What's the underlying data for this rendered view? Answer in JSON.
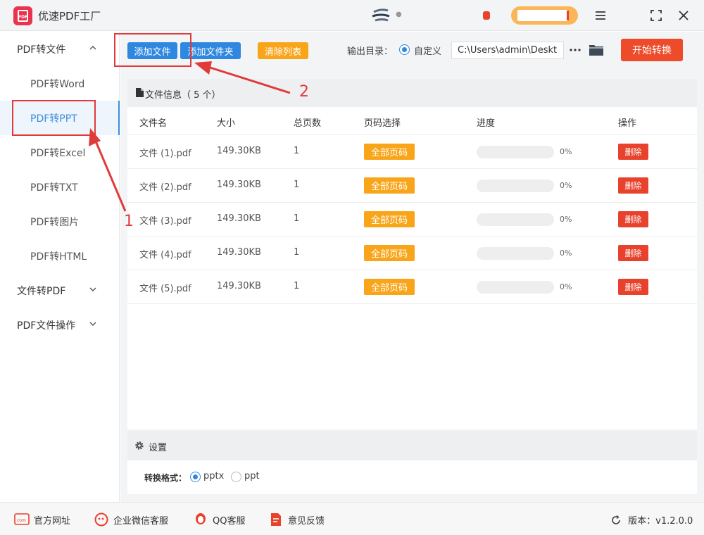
{
  "app": {
    "title": "优速PDF工厂",
    "logo_text": "PDF"
  },
  "sidebar": {
    "groups": [
      {
        "label": "PDF转文件",
        "expanded": true
      },
      {
        "label": "文件转PDF",
        "expanded": false
      },
      {
        "label": "PDF文件操作",
        "expanded": false
      }
    ],
    "items": [
      {
        "label": "PDF转Word"
      },
      {
        "label": "PDF转PPT",
        "active": true
      },
      {
        "label": "PDF转Excel"
      },
      {
        "label": "PDF转TXT"
      },
      {
        "label": "PDF转图片"
      },
      {
        "label": "PDF转HTML"
      }
    ]
  },
  "toolbar": {
    "add_file": "添加文件",
    "add_folder": "添加文件夹",
    "clear_list": "清除列表",
    "output_label": "输出目录：",
    "output_option": "自定义",
    "output_path": "C:\\Users\\admin\\Desktop",
    "start": "开始转换"
  },
  "file_panel": {
    "header": "文件信息（ 5 个）",
    "columns": [
      "文件名",
      "大小",
      "总页数",
      "页码选择",
      "进度",
      "操作"
    ],
    "rows": [
      {
        "name": "文件 (1).pdf",
        "size": "149.30KB",
        "pages": "1",
        "page_sel": "全部页码",
        "progress": 0,
        "progress_text": "0%",
        "action": "删除"
      },
      {
        "name": "文件 (2).pdf",
        "size": "149.30KB",
        "pages": "1",
        "page_sel": "全部页码",
        "progress": 0,
        "progress_text": "0%",
        "action": "删除"
      },
      {
        "name": "文件 (3).pdf",
        "size": "149.30KB",
        "pages": "1",
        "page_sel": "全部页码",
        "progress": 0,
        "progress_text": "0%",
        "action": "删除"
      },
      {
        "name": "文件 (4).pdf",
        "size": "149.30KB",
        "pages": "1",
        "page_sel": "全部页码",
        "progress": 0,
        "progress_text": "0%",
        "action": "删除"
      },
      {
        "name": "文件 (5).pdf",
        "size": "149.30KB",
        "pages": "1",
        "page_sel": "全部页码",
        "progress": 0,
        "progress_text": "0%",
        "action": "删除"
      }
    ]
  },
  "settings": {
    "title": "设置",
    "format_label": "转换格式：",
    "options": [
      {
        "label": "pptx",
        "selected": true
      },
      {
        "label": "ppt",
        "selected": false
      }
    ]
  },
  "footer": {
    "website": "官方网址",
    "wechat": "企业微信客服",
    "qq": "QQ客服",
    "feedback": "意见反馈",
    "version": "版本：v1.2.0.0"
  },
  "annotations": {
    "label_1": "1",
    "label_2": "2"
  },
  "colors": {
    "primary": "#2f87e0",
    "orange": "#f9a51a",
    "red": "#e8412c",
    "annotation": "#e03b3b"
  }
}
